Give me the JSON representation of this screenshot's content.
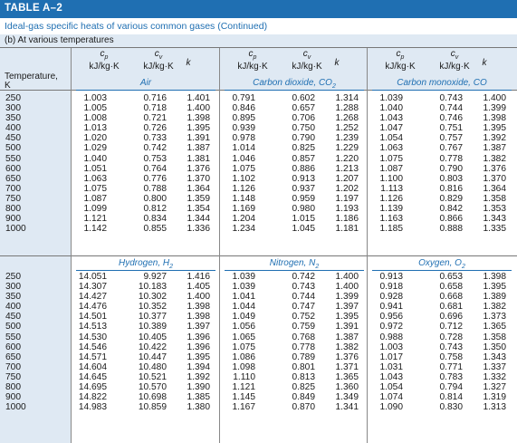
{
  "table": {
    "title": "TABLE A–2",
    "caption": "Ideal-gas specific heats of various common gases (Continued)",
    "subcaption": "(b) At various temperatures",
    "temperature_label": "Temperature,",
    "temperature_unit": "K",
    "header_symbols": {
      "cp": "c",
      "cp_sub": "p",
      "cv": "c",
      "cv_sub": "v",
      "k": "k"
    },
    "header_unit": "kJ/kg·K"
  },
  "top": {
    "temperatures": [
      "250",
      "300",
      "350",
      "400",
      "450",
      "500",
      "550",
      "600",
      "650",
      "700",
      "750",
      "800",
      "900",
      "1000"
    ],
    "gases": [
      {
        "name": "Air",
        "sub": "",
        "cp": [
          "1.003",
          "1.005",
          "1.008",
          "1.013",
          "1.020",
          "1.029",
          "1.040",
          "1.051",
          "1.063",
          "1.075",
          "1.087",
          "1.099",
          "1.121",
          "1.142"
        ],
        "cv": [
          "0.716",
          "0.718",
          "0.721",
          "0.726",
          "0.733",
          "0.742",
          "0.753",
          "0.764",
          "0.776",
          "0.788",
          "0.800",
          "0.812",
          "0.834",
          "0.855"
        ],
        "k": [
          "1.401",
          "1.400",
          "1.398",
          "1.395",
          "1.391",
          "1.387",
          "1.381",
          "1.376",
          "1.370",
          "1.364",
          "1.359",
          "1.354",
          "1.344",
          "1.336"
        ]
      },
      {
        "name": "Carbon dioxide, CO",
        "sub": "2",
        "cp": [
          "0.791",
          "0.846",
          "0.895",
          "0.939",
          "0.978",
          "1.014",
          "1.046",
          "1.075",
          "1.102",
          "1.126",
          "1.148",
          "1.169",
          "1.204",
          "1.234"
        ],
        "cv": [
          "0.602",
          "0.657",
          "0.706",
          "0.750",
          "0.790",
          "0.825",
          "0.857",
          "0.886",
          "0.913",
          "0.937",
          "0.959",
          "0.980",
          "1.015",
          "1.045"
        ],
        "k": [
          "1.314",
          "1.288",
          "1.268",
          "1.252",
          "1.239",
          "1.229",
          "1.220",
          "1.213",
          "1.207",
          "1.202",
          "1.197",
          "1.193",
          "1.186",
          "1.181"
        ]
      },
      {
        "name": "Carbon monoxide, CO",
        "sub": "",
        "cp": [
          "1.039",
          "1.040",
          "1.043",
          "1.047",
          "1.054",
          "1.063",
          "1.075",
          "1.087",
          "1.100",
          "1.113",
          "1.126",
          "1.139",
          "1.163",
          "1.185"
        ],
        "cv": [
          "0.743",
          "0.744",
          "0.746",
          "0.751",
          "0.757",
          "0.767",
          "0.778",
          "0.790",
          "0.803",
          "0.816",
          "0.829",
          "0.842",
          "0.866",
          "0.888"
        ],
        "k": [
          "1.400",
          "1.399",
          "1.398",
          "1.395",
          "1.392",
          "1.387",
          "1.382",
          "1.376",
          "1.370",
          "1.364",
          "1.358",
          "1.353",
          "1.343",
          "1.335"
        ]
      }
    ]
  },
  "bottom": {
    "temperatures": [
      "250",
      "300",
      "350",
      "400",
      "450",
      "500",
      "550",
      "600",
      "650",
      "700",
      "750",
      "800",
      "900",
      "1000"
    ],
    "gases": [
      {
        "name": "Hydrogen, H",
        "sub": "2",
        "cp": [
          "14.051",
          "14.307",
          "14.427",
          "14.476",
          "14.501",
          "14.513",
          "14.530",
          "14.546",
          "14.571",
          "14.604",
          "14.645",
          "14.695",
          "14.822",
          "14.983"
        ],
        "cv": [
          "9.927",
          "10.183",
          "10.302",
          "10.352",
          "10.377",
          "10.389",
          "10.405",
          "10.422",
          "10.447",
          "10.480",
          "10.521",
          "10.570",
          "10.698",
          "10.859"
        ],
        "k": [
          "1.416",
          "1.405",
          "1.400",
          "1.398",
          "1.398",
          "1.397",
          "1.396",
          "1.396",
          "1.395",
          "1.394",
          "1.392",
          "1.390",
          "1.385",
          "1.380"
        ]
      },
      {
        "name": "Nitrogen, N",
        "sub": "2",
        "cp": [
          "1.039",
          "1.039",
          "1.041",
          "1.044",
          "1.049",
          "1.056",
          "1.065",
          "1.075",
          "1.086",
          "1.098",
          "1.110",
          "1.121",
          "1.145",
          "1.167"
        ],
        "cv": [
          "0.742",
          "0.743",
          "0.744",
          "0.747",
          "0.752",
          "0.759",
          "0.768",
          "0.778",
          "0.789",
          "0.801",
          "0.813",
          "0.825",
          "0.849",
          "0.870"
        ],
        "k": [
          "1.400",
          "1.400",
          "1.399",
          "1.397",
          "1.395",
          "1.391",
          "1.387",
          "1.382",
          "1.376",
          "1.371",
          "1.365",
          "1.360",
          "1.349",
          "1.341"
        ]
      },
      {
        "name": "Oxygen, O",
        "sub": "2",
        "cp": [
          "0.913",
          "0.918",
          "0.928",
          "0.941",
          "0.956",
          "0.972",
          "0.988",
          "1.003",
          "1.017",
          "1.031",
          "1.043",
          "1.054",
          "1.074",
          "1.090"
        ],
        "cv": [
          "0.653",
          "0.658",
          "0.668",
          "0.681",
          "0.696",
          "0.712",
          "0.728",
          "0.743",
          "0.758",
          "0.771",
          "0.783",
          "0.794",
          "0.814",
          "0.830"
        ],
        "k": [
          "1.398",
          "1.395",
          "1.389",
          "1.382",
          "1.373",
          "1.365",
          "1.358",
          "1.350",
          "1.343",
          "1.337",
          "1.332",
          "1.327",
          "1.319",
          "1.313"
        ]
      }
    ]
  },
  "colors": {
    "accent": "#1f6fb2",
    "band": "#dfe9f3"
  }
}
